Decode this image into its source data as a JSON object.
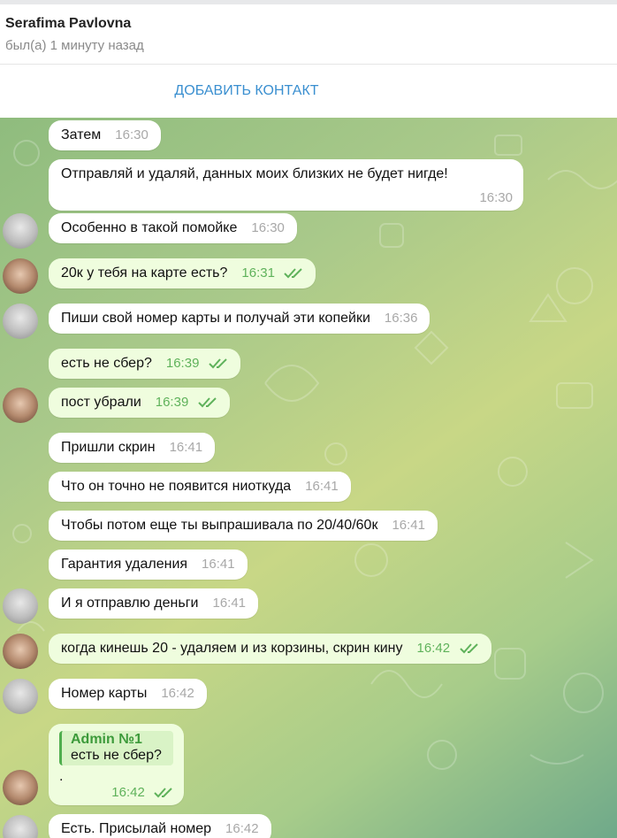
{
  "header": {
    "title": "Serafima Pavlovna",
    "status": "был(а) 1 минуту назад"
  },
  "add_contact_label": "ДОБАВИТЬ КОНТАКТ",
  "colors": {
    "accent": "#3a8fd0",
    "outgoing_bubble": "#effdde",
    "read_ticks": "#5fb25b"
  },
  "messages": [
    {
      "text": "Затем",
      "time": "16:30",
      "dir": "in"
    },
    {
      "text": "Отправляй и удаляй, данных моих близких не будет нигде!",
      "time": "16:30",
      "dir": "in"
    },
    {
      "text": "Особенно в такой помойке",
      "time": "16:30",
      "dir": "in"
    },
    {
      "text": "20к у тебя на карте есть?",
      "time": "16:31",
      "dir": "out"
    },
    {
      "text": "Пиши свой номер карты и получай эти копейки",
      "time": "16:36",
      "dir": "in"
    },
    {
      "text": "есть не сбер?",
      "time": "16:39",
      "dir": "out"
    },
    {
      "text": "пост убрали",
      "time": "16:39",
      "dir": "out"
    },
    {
      "text": "Пришли скрин",
      "time": "16:41",
      "dir": "in"
    },
    {
      "text": "Что он точно не появится ниоткуда",
      "time": "16:41",
      "dir": "in"
    },
    {
      "text": "Чтобы потом еще ты выпрашивала по 20/40/60к",
      "time": "16:41",
      "dir": "in"
    },
    {
      "text": "Гарантия удаления",
      "time": "16:41",
      "dir": "in"
    },
    {
      "text": "И я отправлю деньги",
      "time": "16:41",
      "dir": "in"
    },
    {
      "text": "когда кинешь 20 - удаляем и из корзины, скрин кину",
      "time": "16:42",
      "dir": "out"
    },
    {
      "text": "Номер карты",
      "time": "16:42",
      "dir": "in"
    },
    {
      "text": ".",
      "time": "16:42",
      "dir": "out",
      "reply_to": {
        "name": "Admin №1",
        "text": "есть не сбер?"
      }
    },
    {
      "text": "Есть. Присылай номер",
      "time": "16:42",
      "dir": "in"
    }
  ]
}
